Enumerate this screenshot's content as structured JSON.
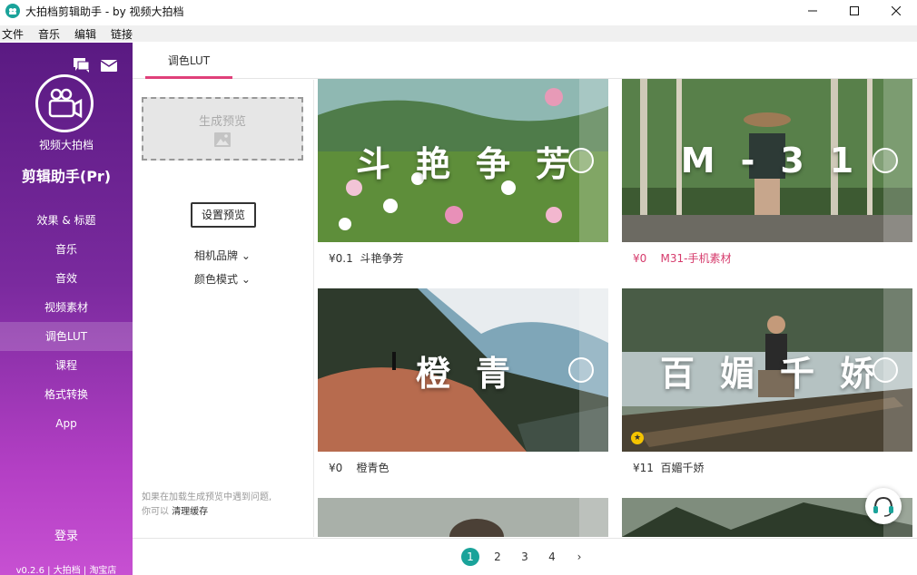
{
  "window": {
    "title": "大拍档剪辑助手 - by 视频大拍档"
  },
  "menubar": [
    "文件",
    "音乐",
    "编辑",
    "链接"
  ],
  "sidebar": {
    "logo_text": "视频大拍档",
    "product_name": "剪辑助手(Pr)",
    "nav": [
      "效果 & 标题",
      "音乐",
      "音效",
      "视频素材",
      "调色LUT",
      "课程",
      "格式转换",
      "App"
    ],
    "active_index": 4,
    "login": "登录",
    "version": "v0.2.6",
    "link_site": "大拍档",
    "link_shop": "淘宝店"
  },
  "tabs": [
    {
      "label": "调色LUT",
      "active": true
    }
  ],
  "left_panel": {
    "preview_placeholder": "生成预览",
    "set_preview_button": "设置预览",
    "camera_brand": "相机品牌",
    "color_mode": "颜色模式",
    "note_line1": "如果在加载生成预览中遇到问题,",
    "note_line2_prefix": "你可以",
    "note_link": "清理缓存"
  },
  "cards": [
    {
      "overlay": "斗艳争芳",
      "price": "¥0.1",
      "name": "斗艳争芳",
      "pink": false,
      "featured": false
    },
    {
      "overlay": "M-31",
      "price": "¥0",
      "name": "M31-手机素材",
      "pink": true,
      "featured": false
    },
    {
      "overlay": "橙青",
      "price": "¥0",
      "name": "橙青色",
      "pink": false,
      "featured": false
    },
    {
      "overlay": "百媚千娇",
      "price": "¥11",
      "name": "百媚千娇",
      "pink": false,
      "featured": true
    }
  ],
  "pagination": {
    "pages": [
      "1",
      "2",
      "3",
      "4"
    ],
    "current": "1",
    "next": "›"
  },
  "colors": {
    "accent": "#1aa39a",
    "tab_underline": "#e0407a",
    "price_pink": "#d63b6c"
  }
}
